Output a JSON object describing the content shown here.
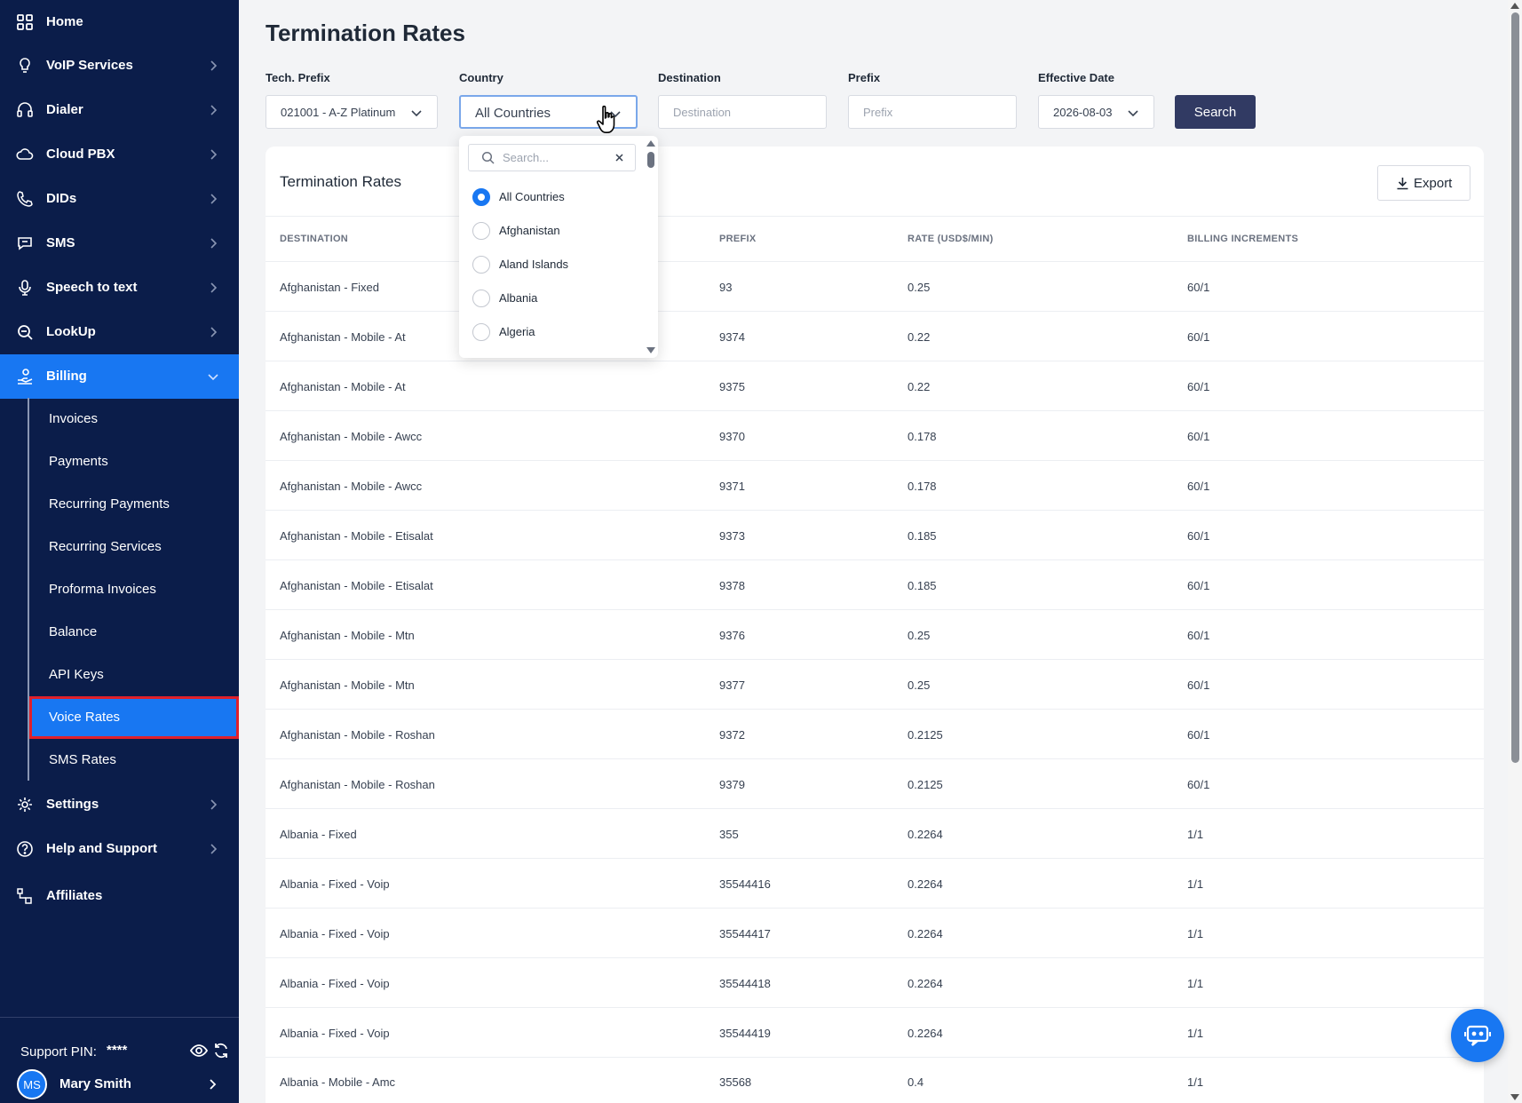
{
  "sidebar": {
    "nav": [
      {
        "label": "Home",
        "icon": "grid-icon"
      },
      {
        "label": "VoIP Services",
        "icon": "lightbulb-icon"
      },
      {
        "label": "Dialer",
        "icon": "headset-icon"
      },
      {
        "label": "Cloud PBX",
        "icon": "cloud-icon"
      },
      {
        "label": "DIDs",
        "icon": "phone-icon"
      },
      {
        "label": "SMS",
        "icon": "message-icon"
      },
      {
        "label": "Speech to text",
        "icon": "microphone-icon"
      },
      {
        "label": "LookUp",
        "icon": "zoom-icon"
      },
      {
        "label": "Billing",
        "icon": "hand-coin-icon"
      }
    ],
    "billing_sub": [
      {
        "label": "Invoices"
      },
      {
        "label": "Payments"
      },
      {
        "label": "Recurring Payments"
      },
      {
        "label": "Recurring Services"
      },
      {
        "label": "Proforma Invoices"
      },
      {
        "label": "Balance"
      },
      {
        "label": "API Keys"
      },
      {
        "label": "Voice Rates"
      },
      {
        "label": "SMS Rates"
      }
    ],
    "nav_bottom": [
      {
        "label": "Settings",
        "icon": "gear-icon"
      },
      {
        "label": "Help and Support",
        "icon": "help-icon"
      },
      {
        "label": "Affiliates",
        "icon": "affiliates-icon"
      }
    ],
    "footer": {
      "pin_label": "Support PIN:",
      "pin_value": "****",
      "avatar_initials": "MS",
      "user_name": "Mary Smith"
    }
  },
  "page": {
    "title": "Termination Rates"
  },
  "filters": {
    "tech_prefix": {
      "label": "Tech. Prefix",
      "value": "021001 - A-Z Platinum"
    },
    "country": {
      "label": "Country",
      "value": "All Countries"
    },
    "destination": {
      "label": "Destination",
      "placeholder": "Destination"
    },
    "prefix": {
      "label": "Prefix",
      "placeholder": "Prefix"
    },
    "effective_date": {
      "label": "Effective Date",
      "value": "2026-08-03"
    },
    "search_label": "Search"
  },
  "country_dropdown": {
    "search_placeholder": "Search...",
    "options": [
      {
        "label": "All Countries",
        "selected": true
      },
      {
        "label": "Afghanistan",
        "selected": false
      },
      {
        "label": "Aland Islands",
        "selected": false
      },
      {
        "label": "Albania",
        "selected": false
      },
      {
        "label": "Algeria",
        "selected": false
      }
    ]
  },
  "table": {
    "title": "Termination Rates",
    "export_label": "Export",
    "columns": [
      "DESTINATION",
      "PREFIX",
      "RATE (USD$/MIN)",
      "BILLING INCREMENTS"
    ],
    "rows": [
      [
        "Afghanistan - Fixed",
        "93",
        "0.25",
        "60/1"
      ],
      [
        "Afghanistan - Mobile - At",
        "9374",
        "0.22",
        "60/1"
      ],
      [
        "Afghanistan - Mobile - At",
        "9375",
        "0.22",
        "60/1"
      ],
      [
        "Afghanistan - Mobile - Awcc",
        "9370",
        "0.178",
        "60/1"
      ],
      [
        "Afghanistan - Mobile - Awcc",
        "9371",
        "0.178",
        "60/1"
      ],
      [
        "Afghanistan - Mobile - Etisalat",
        "9373",
        "0.185",
        "60/1"
      ],
      [
        "Afghanistan - Mobile - Etisalat",
        "9378",
        "0.185",
        "60/1"
      ],
      [
        "Afghanistan - Mobile - Mtn",
        "9376",
        "0.25",
        "60/1"
      ],
      [
        "Afghanistan - Mobile - Mtn",
        "9377",
        "0.25",
        "60/1"
      ],
      [
        "Afghanistan - Mobile - Roshan",
        "9372",
        "0.2125",
        "60/1"
      ],
      [
        "Afghanistan - Mobile - Roshan",
        "9379",
        "0.2125",
        "60/1"
      ],
      [
        "Albania - Fixed",
        "355",
        "0.2264",
        "1/1"
      ],
      [
        "Albania - Fixed - Voip",
        "35544416",
        "0.2264",
        "1/1"
      ],
      [
        "Albania - Fixed - Voip",
        "35544417",
        "0.2264",
        "1/1"
      ],
      [
        "Albania - Fixed - Voip",
        "35544418",
        "0.2264",
        "1/1"
      ],
      [
        "Albania - Fixed - Voip",
        "35544419",
        "0.2264",
        "1/1"
      ],
      [
        "Albania - Mobile - Amc",
        "35568",
        "0.4",
        "1/1"
      ]
    ]
  },
  "colors": {
    "sidebar_bg": "#0b1d4a",
    "accent": "#1877f2",
    "search_button": "#313a63",
    "highlight_outline": "#e0202a"
  }
}
